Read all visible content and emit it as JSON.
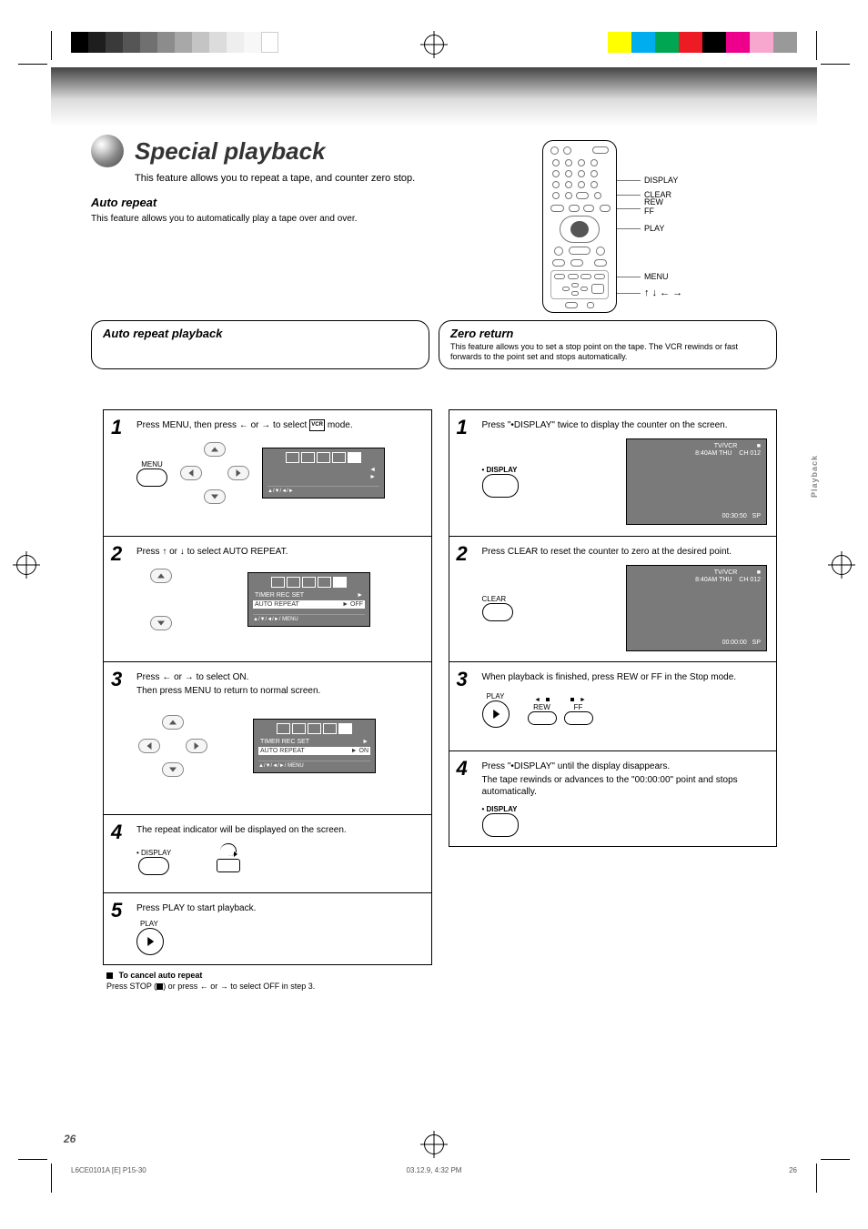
{
  "header": {
    "title": "Special playback",
    "subtitle": "This feature allows you to repeat a tape, and counter zero stop.",
    "intro_title": "Auto repeat",
    "intro_text": "This feature allows you to automatically play a tape over and over."
  },
  "remote": {
    "labels": {
      "display": "DISPLAY",
      "clear": "CLEAR",
      "menu": "MENU",
      "rew": "REW",
      "ff": "FF",
      "play": "PLAY",
      "arrows": "↑ ↓ ← →"
    }
  },
  "tab_left": "Auto repeat playback",
  "tab_right_title": "Zero return",
  "tab_right_sub": "This feature allows you to set a stop point on the tape. The VCR rewinds or fast forwards to the point set and stops automatically.",
  "left_steps": {
    "s1": {
      "num": "1",
      "line1_a": "Press MENU, then press ",
      "line1_b": " or ",
      "line1_c": " to select ",
      "line1_d": " mode.",
      "btn_label": "MENU",
      "osd_footer": "▲/▼/◄/►",
      "osd_prompt": "◄\n►"
    },
    "s2": {
      "num": "2",
      "line_a": "Press ",
      "line_b": " or ",
      "line_c": " to select AUTO REPEAT.",
      "osd": {
        "row1_l": "TIMER  REC  SET",
        "row1_r": "►",
        "row2_l": "AUTO  REPEAT",
        "row2_r": "► OFF",
        "footer": "▲/▼/◄/►/ MENU"
      }
    },
    "s3": {
      "num": "3",
      "line_a": "Press ",
      "line_b": " or ",
      "line_c": " to select ON.",
      "sub": "Then press MENU to return to normal screen.",
      "osd": {
        "row1_l": "TIMER  REC  SET",
        "row1_r": "►",
        "row2_l": "AUTO  REPEAT",
        "row2_r": "► ON",
        "footer": "▲/▼/◄/►/ MENU"
      }
    },
    "s4": {
      "num": "4",
      "line": "The repeat indicator will be displayed on the screen.",
      "btn_label": "• DISPLAY"
    },
    "s5": {
      "num": "5",
      "line": "Press PLAY to start playback.",
      "btn_label": "PLAY"
    },
    "footnote_a": "To cancel auto repeat",
    "footnote_b": "Press STOP (",
    "footnote_c": ") or press ",
    "footnote_d": " or ",
    "footnote_e": " to select OFF in step 3."
  },
  "right_steps": {
    "s1": {
      "num": "1",
      "line": "Press \"•DISPLAY\" twice to display the counter on the screen.",
      "btn_label": "• DISPLAY",
      "tv": {
        "top_l1": "TV/VCR",
        "top_l2": "8:40AM  THU",
        "top_r": "CH 012",
        "bot_c": "00:30:50",
        "bot_r": "SP",
        "sq": "■"
      }
    },
    "s2": {
      "num": "2",
      "line": "Press CLEAR to reset the counter to zero at the desired point.",
      "btn_label": "CLEAR",
      "tv": {
        "top_l1": "TV/VCR",
        "top_l2": "8:40AM  THU",
        "top_r": "CH 012",
        "bot_c": "00:00:00",
        "bot_r": "SP",
        "sq": "■"
      }
    },
    "s3": {
      "num": "3",
      "line": "When playback is finished, press REW or FF in the Stop mode.",
      "btn_label_play": "PLAY",
      "btn_label_rew": "REW",
      "btn_label_ff": "FF"
    },
    "s4": {
      "num": "4",
      "line": "Press \"•DISPLAY\" until the display disappears.",
      "sub": "The tape rewinds or advances to the \"00:00:00\" point and stops automatically.",
      "btn_label": "• DISPLAY"
    }
  },
  "side_label": "Playback",
  "page_num": "26",
  "footer": {
    "file": "L6CE0101A [E] P15-30",
    "page": "26",
    "date": "03.12.9, 4:32 PM"
  }
}
